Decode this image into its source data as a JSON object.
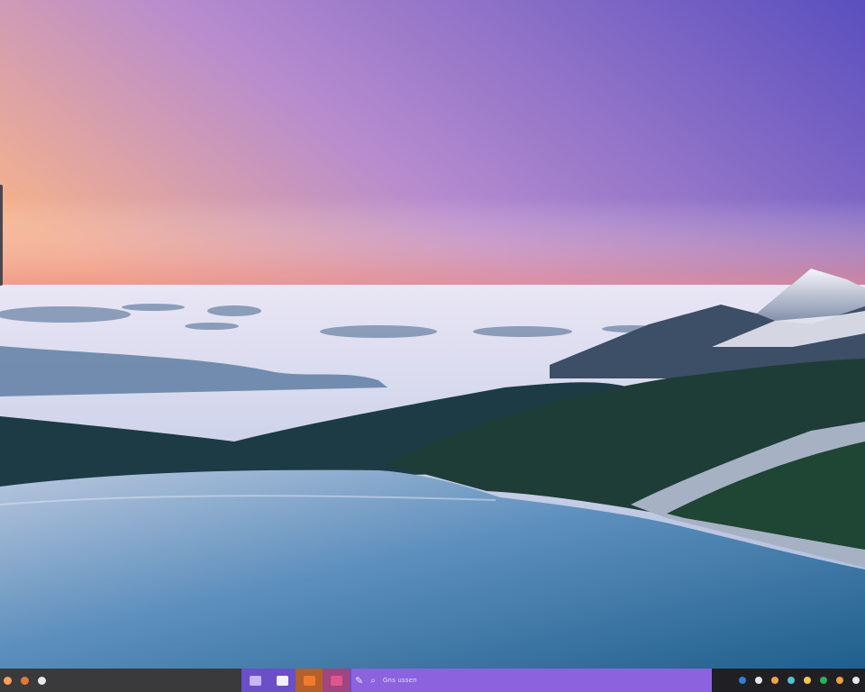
{
  "desktop": {
    "wallpaper_name": "mountain-lake-sunset-wallpaper"
  },
  "taskbar": {
    "left_icons": [
      {
        "name": "system-icon",
        "color": "#f2a25a"
      },
      {
        "name": "app-icon",
        "color": "#e07a3a"
      },
      {
        "name": "settings-icon",
        "color": "#e8e8e8"
      }
    ],
    "pinned_apps": [
      {
        "name": "pen-app-icon",
        "color": "#c7b5ff"
      },
      {
        "name": "photos-app-icon",
        "color": "#f2f2ff"
      },
      {
        "name": "office-app-icon",
        "color": "#f07b2d"
      },
      {
        "name": "notes-app-icon",
        "color": "#e0558b"
      }
    ],
    "search": {
      "icons": [
        "assistant-icon",
        "search-icon"
      ],
      "text": "Gns ussen"
    },
    "tray_icons": [
      {
        "name": "tray-icon-1",
        "color": "#2f7ed8"
      },
      {
        "name": "tray-icon-2",
        "color": "#e5e5f0"
      },
      {
        "name": "tray-icon-3",
        "color": "#f0a24a"
      },
      {
        "name": "tray-icon-4",
        "color": "#56c2d0"
      },
      {
        "name": "tray-icon-5",
        "color": "#f2c84b"
      },
      {
        "name": "tray-icon-6",
        "color": "#29b35a"
      },
      {
        "name": "tray-icon-7",
        "color": "#f0a040"
      },
      {
        "name": "tray-icon-8",
        "color": "#e8e8e8"
      }
    ]
  }
}
